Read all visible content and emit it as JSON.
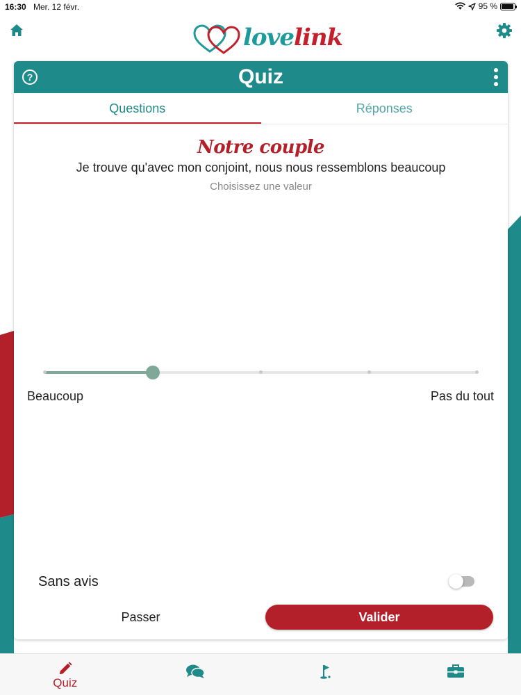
{
  "status_bar": {
    "time": "16:30",
    "date": "Mer. 12 févr.",
    "battery": "95 %"
  },
  "header": {
    "logo_love": "love",
    "logo_link": "link"
  },
  "card": {
    "title": "Quiz",
    "tabs": [
      {
        "label": "Questions",
        "active": true
      },
      {
        "label": "Réponses",
        "active": false
      }
    ],
    "category": "Notre couple",
    "question": "Je trouve qu'avec mon conjoint, nous nous ressemblons beaucoup",
    "hint": "Choisissez une valeur",
    "slider": {
      "min_label": "Beaucoup",
      "max_label": "Pas du tout",
      "steps": 5,
      "selected_step": 1
    },
    "no_opinion_label": "Sans avis",
    "no_opinion_enabled": false,
    "skip_label": "Passer",
    "validate_label": "Valider"
  },
  "tab_bar": {
    "items": [
      {
        "name": "quiz",
        "label": "Quiz",
        "icon": "pencil-icon",
        "active": true
      },
      {
        "name": "chat",
        "label": "",
        "icon": "chat-bubbles-icon",
        "active": false
      },
      {
        "name": "goal",
        "label": "",
        "icon": "golf-flag-icon",
        "active": false
      },
      {
        "name": "toolbox",
        "label": "",
        "icon": "toolbox-icon",
        "active": false
      }
    ]
  },
  "colors": {
    "teal": "#1e8a8a",
    "red": "#b3202a",
    "slider": "#7fa898"
  }
}
